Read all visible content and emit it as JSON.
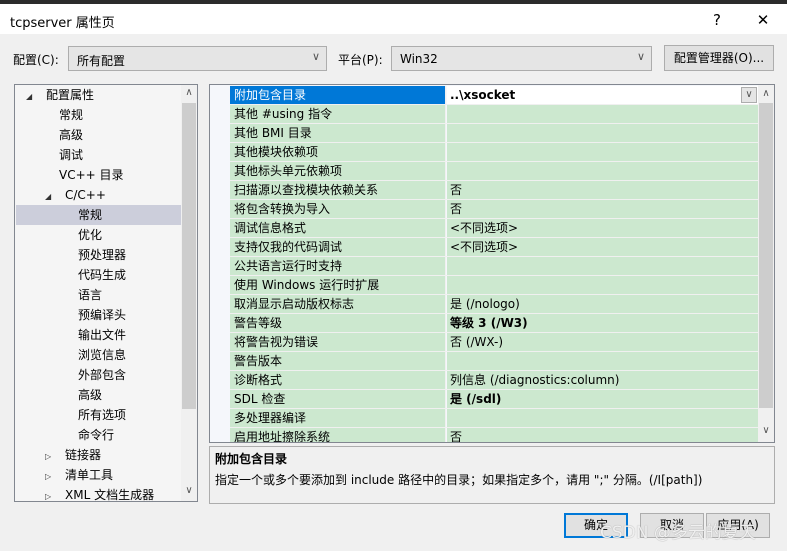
{
  "window": {
    "title": "tcpserver 属性页",
    "help": "?",
    "close": "✕"
  },
  "toolbar": {
    "config_label": "配置(C):",
    "config_value": "所有配置",
    "platform_label": "平台(P):",
    "platform_value": "Win32",
    "config_manager": "配置管理器(O)..."
  },
  "tree": [
    {
      "label": "配置属性",
      "level": 0,
      "expander": "expanded"
    },
    {
      "label": "常规",
      "level": 1
    },
    {
      "label": "高级",
      "level": 1
    },
    {
      "label": "调试",
      "level": 1
    },
    {
      "label": "VC++ 目录",
      "level": 1
    },
    {
      "label": "C/C++",
      "level": 1,
      "expander": "expanded"
    },
    {
      "label": "常规",
      "level": 2,
      "selected": true
    },
    {
      "label": "优化",
      "level": 2
    },
    {
      "label": "预处理器",
      "level": 2
    },
    {
      "label": "代码生成",
      "level": 2
    },
    {
      "label": "语言",
      "level": 2
    },
    {
      "label": "预编译头",
      "level": 2
    },
    {
      "label": "输出文件",
      "level": 2
    },
    {
      "label": "浏览信息",
      "level": 2
    },
    {
      "label": "外部包含",
      "level": 2
    },
    {
      "label": "高级",
      "level": 2
    },
    {
      "label": "所有选项",
      "level": 2
    },
    {
      "label": "命令行",
      "level": 2
    },
    {
      "label": "链接器",
      "level": 1,
      "expander": "collapsed"
    },
    {
      "label": "清单工具",
      "level": 1,
      "expander": "collapsed"
    },
    {
      "label": "XML 文档生成器",
      "level": 1,
      "expander": "collapsed"
    }
  ],
  "properties": [
    {
      "name": "附加包含目录",
      "value": "..\\xsocket",
      "selected": true
    },
    {
      "name": "其他 #using 指令",
      "value": ""
    },
    {
      "name": "其他 BMI 目录",
      "value": ""
    },
    {
      "name": "其他模块依赖项",
      "value": ""
    },
    {
      "name": "其他标头单元依赖项",
      "value": ""
    },
    {
      "name": "扫描源以查找模块依赖关系",
      "value": "否"
    },
    {
      "name": "将包含转换为导入",
      "value": "否"
    },
    {
      "name": "调试信息格式",
      "value": "<不同选项>"
    },
    {
      "name": "支持仅我的代码调试",
      "value": "<不同选项>"
    },
    {
      "name": "公共语言运行时支持",
      "value": ""
    },
    {
      "name": "使用 Windows 运行时扩展",
      "value": ""
    },
    {
      "name": "取消显示启动版权标志",
      "value": "是 (/nologo)"
    },
    {
      "name": "警告等级",
      "value": "等级 3 (/W3)",
      "bold": true
    },
    {
      "name": "将警告视为错误",
      "value": "否 (/WX-)"
    },
    {
      "name": "警告版本",
      "value": ""
    },
    {
      "name": "诊断格式",
      "value": "列信息 (/diagnostics:column)"
    },
    {
      "name": "SDL 检查",
      "value": "是 (/sdl)",
      "bold": true
    },
    {
      "name": "多处理器编译",
      "value": ""
    },
    {
      "name": "启用地址擦除系统",
      "value": "否"
    }
  ],
  "description": {
    "title": "附加包含目录",
    "text": "指定一个或多个要添加到 include 路径中的目录；如果指定多个，请用 \";\" 分隔。(/I[path])"
  },
  "buttons": {
    "ok": "确定",
    "cancel": "取消",
    "apply": "应用(A)"
  },
  "watermark": "CSDN @多云的夏天"
}
